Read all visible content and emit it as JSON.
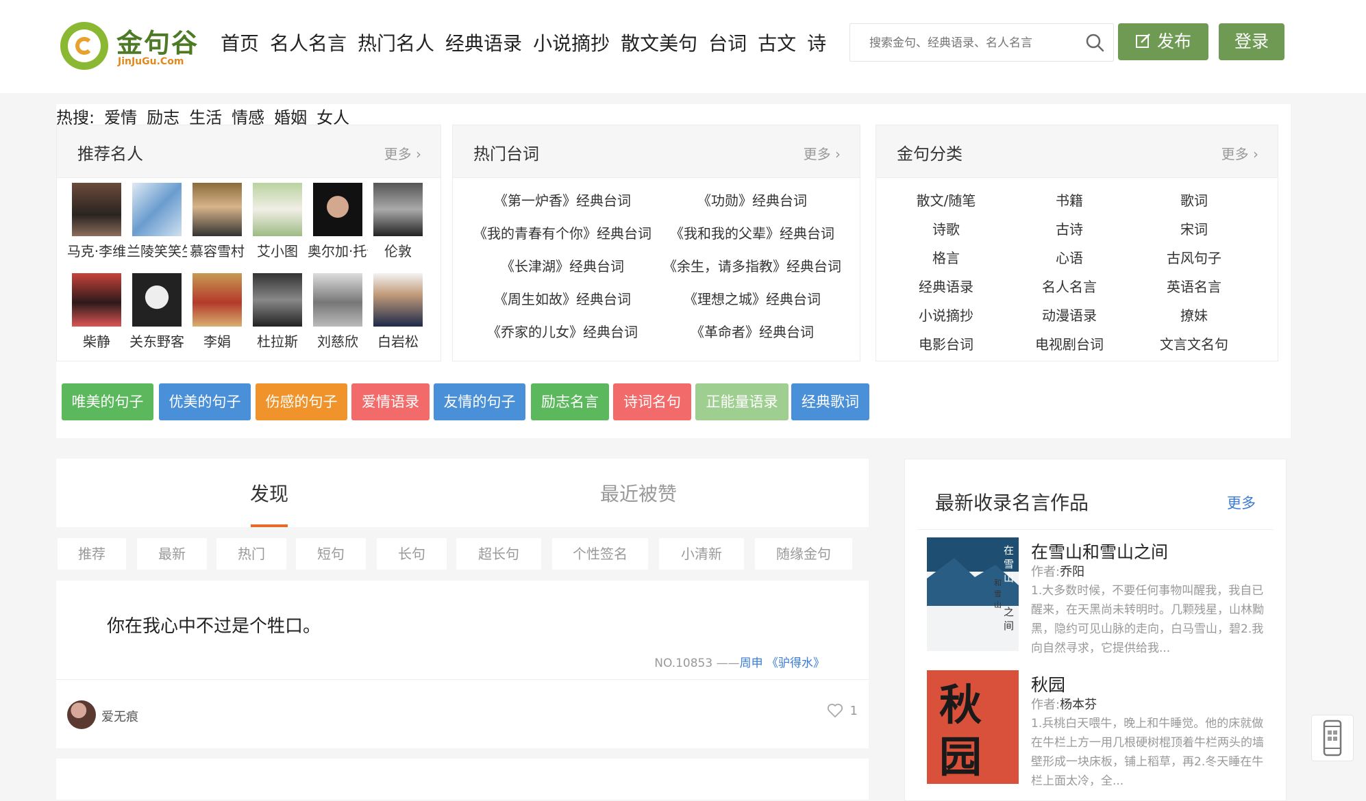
{
  "header": {
    "logo_name": "金句谷",
    "logo_sub": "JinJuGu.Com",
    "nav": [
      "首页",
      "名人名言",
      "热门名人",
      "经典语录",
      "小说摘抄",
      "散文美句",
      "台词",
      "古文",
      "诗"
    ],
    "search_placeholder": "搜索金句、经典语录、名人名言",
    "publish_label": "发布",
    "login_label": "登录"
  },
  "celebrities": {
    "title": "推荐名人",
    "more": "更多",
    "row1": [
      "马克·李维",
      "兰陵笑笑生",
      "慕容雪村",
      "艾小图",
      "奥尔加·托卡尔丘克",
      "伦敦"
    ],
    "row2": [
      "柴静",
      "关东野客",
      "李娟",
      "杜拉斯",
      "刘慈欣",
      "白岩松"
    ]
  },
  "lines": {
    "title": "热门台词",
    "more": "更多",
    "items": [
      [
        "《第一炉香》经典台词",
        "《功勋》经典台词"
      ],
      [
        "《我的青春有个你》经典台词",
        "《我和我的父辈》经典台词"
      ],
      [
        "《长津湖》经典台词",
        "《余生，请多指教》经典台词"
      ],
      [
        "《周生如故》经典台词",
        "《理想之城》经典台词"
      ],
      [
        "《乔家的儿女》经典台词",
        "《革命者》经典台词"
      ]
    ]
  },
  "categories": {
    "title": "金句分类",
    "more": "更多",
    "items": [
      [
        "散文/随笔",
        "书籍",
        "歌词"
      ],
      [
        "诗歌",
        "古诗",
        "宋词"
      ],
      [
        "格言",
        "心语",
        "古风句子"
      ],
      [
        "经典语录",
        "名人名言",
        "英语名言"
      ],
      [
        "小说摘抄",
        "动漫语录",
        "撩妹"
      ],
      [
        "电影台词",
        "电视剧台词",
        "文言文名句"
      ]
    ]
  },
  "tags": [
    {
      "label": "唯美的句子",
      "color": "#5cb85c"
    },
    {
      "label": "优美的句子",
      "color": "#4a90d9"
    },
    {
      "label": "伤感的句子",
      "color": "#f0932b"
    },
    {
      "label": "爱情语录",
      "color": "#f26a6a"
    },
    {
      "label": "友情的句子",
      "color": "#4a90d9"
    },
    {
      "label": "励志名言",
      "color": "#5cb85c"
    },
    {
      "label": "诗词名句",
      "color": "#f26a6a"
    },
    {
      "label": "正能量语录",
      "color": "#9fcf90"
    },
    {
      "label": "经典歌词",
      "color": "#4a90d9"
    }
  ],
  "hot_search": {
    "label": "热搜:",
    "items": [
      "爱情",
      "励志",
      "生活",
      "情感",
      "婚姻",
      "女人"
    ]
  },
  "feed": {
    "tabs": [
      "发现",
      "最近被赞"
    ],
    "filters": [
      "推荐",
      "最新",
      "热门",
      "短句",
      "长句",
      "超长句",
      "个性签名",
      "小清新",
      "随缘金句"
    ],
    "quote": "你在我心中不过是个牲口。",
    "no": "NO.10853 ——",
    "author": "周申",
    "work": "《驴得水》",
    "user": "爱无痕",
    "likes": "1"
  },
  "sidebar": {
    "title": "最新收录名言作品",
    "more": "更多",
    "author_prefix": "作者:",
    "books": [
      {
        "title": "在雪山和雪山之间",
        "author": "乔阳",
        "desc": "1.大多数时候，不要任何事物叫醒我，我自已醒来，在天黑尚未转明时。几颗残星，山林黝黑，隐约可见山脉的走向，白马雪山，碧2.我向自然寻求，它提供给我..."
      },
      {
        "title": "秋园",
        "author": "杨本芬",
        "desc": "1.兵桃白天喂牛，晚上和牛睡觉。他的床就做在牛栏上方一用几根硬树棍顶着牛栏两头的墙壁形成一块床板，铺上稻草，再2.冬天睡在牛栏上面太冷，全..."
      }
    ]
  }
}
